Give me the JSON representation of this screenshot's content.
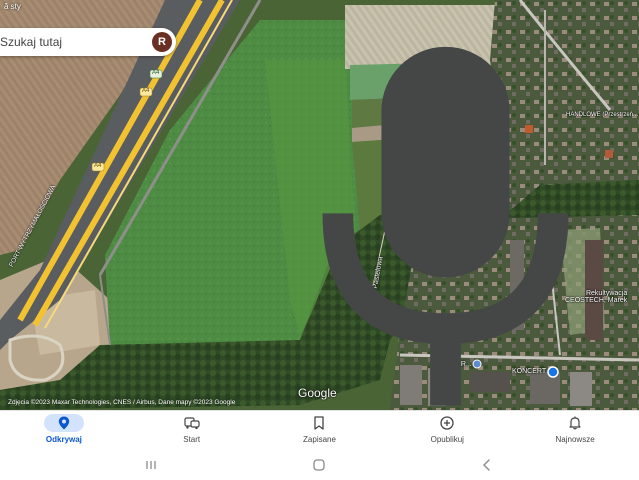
{
  "map": {
    "top_label": "ă sty",
    "labels": {
      "street_left": "PORT WYTRZYMAŁOŚCIOWA",
      "street_field": "Pastelowa",
      "company": "Rekultywacja\nCEOSTECH, Marek",
      "poi_right": "HANDLOWE (Przestrzeń...",
      "poi_bottom": "KONCERT",
      "poi_bottom2": "PAR...",
      "road_shield_1": "A4",
      "road_shield_2": "A4",
      "road_shield_3": "A4"
    },
    "logo": "Google",
    "attribution": "Zdjęcia ©2023 Maxar Technologies, CNES / Airbus, Dane mapy ©2023 Google"
  },
  "search": {
    "placeholder": "Szukaj tutaj",
    "avatar_letter": "R"
  },
  "bottom_nav": {
    "items": [
      {
        "label": "Odkrywaj",
        "icon": "location-pin-icon",
        "active": true
      },
      {
        "label": "Start",
        "icon": "commute-icon",
        "active": false
      },
      {
        "label": "Zapisane",
        "icon": "bookmark-icon",
        "active": false
      },
      {
        "label": "Opublikuj",
        "icon": "add-circle-icon",
        "active": false
      },
      {
        "label": "Najnowsze",
        "icon": "bell-icon",
        "active": false
      }
    ]
  },
  "colors": {
    "accent": "#0b57d0",
    "active_pill": "#d3e3fd",
    "highway": "#f2c230",
    "field_green": "#4f8f45"
  }
}
